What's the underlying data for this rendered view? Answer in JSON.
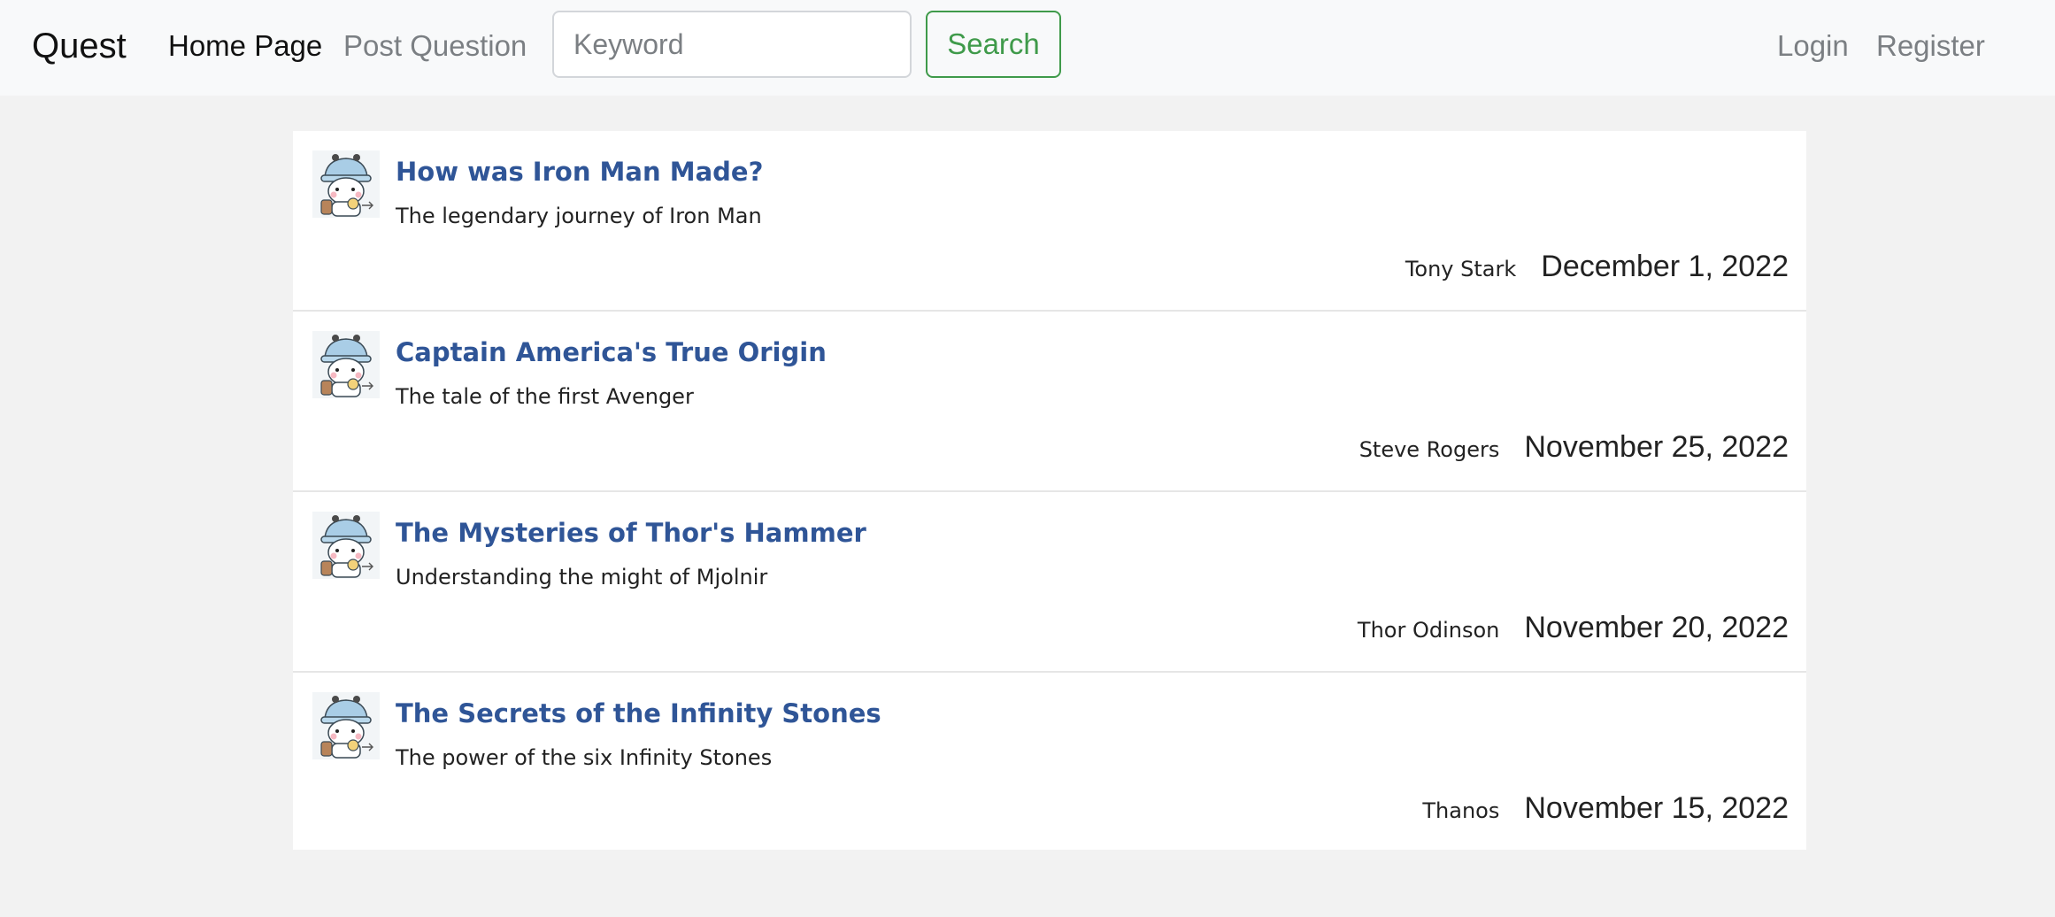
{
  "navbar": {
    "brand": "Quest",
    "home_label": "Home Page",
    "post_label": "Post Question",
    "search_placeholder": "Keyword",
    "search_value": "",
    "search_button_label": "Search",
    "login_label": "Login",
    "register_label": "Register"
  },
  "questions": [
    {
      "title": "How was Iron Man Made?",
      "description": "The legendary journey of Iron Man",
      "author": "Tony Stark",
      "date": "December 1, 2022",
      "avatar_icon": "panda-avatar-icon"
    },
    {
      "title": "Captain America's True Origin",
      "description": "The tale of the first Avenger",
      "author": "Steve Rogers",
      "date": "November 25, 2022",
      "avatar_icon": "panda-avatar-icon"
    },
    {
      "title": "The Mysteries of Thor's Hammer",
      "description": "Understanding the might of Mjolnir",
      "author": "Thor Odinson",
      "date": "November 20, 2022",
      "avatar_icon": "panda-avatar-icon"
    },
    {
      "title": "The Secrets of the Infinity Stones",
      "description": "The power of the six Infinity Stones",
      "author": "Thanos",
      "date": "November 15, 2022",
      "avatar_icon": "panda-avatar-icon"
    }
  ],
  "colors": {
    "navbar_bg": "#f8f9fa",
    "page_bg": "#f2f2f2",
    "title_link": "#2f5597",
    "search_accent": "#3f9a4a",
    "muted_link": "#7b7f83"
  }
}
